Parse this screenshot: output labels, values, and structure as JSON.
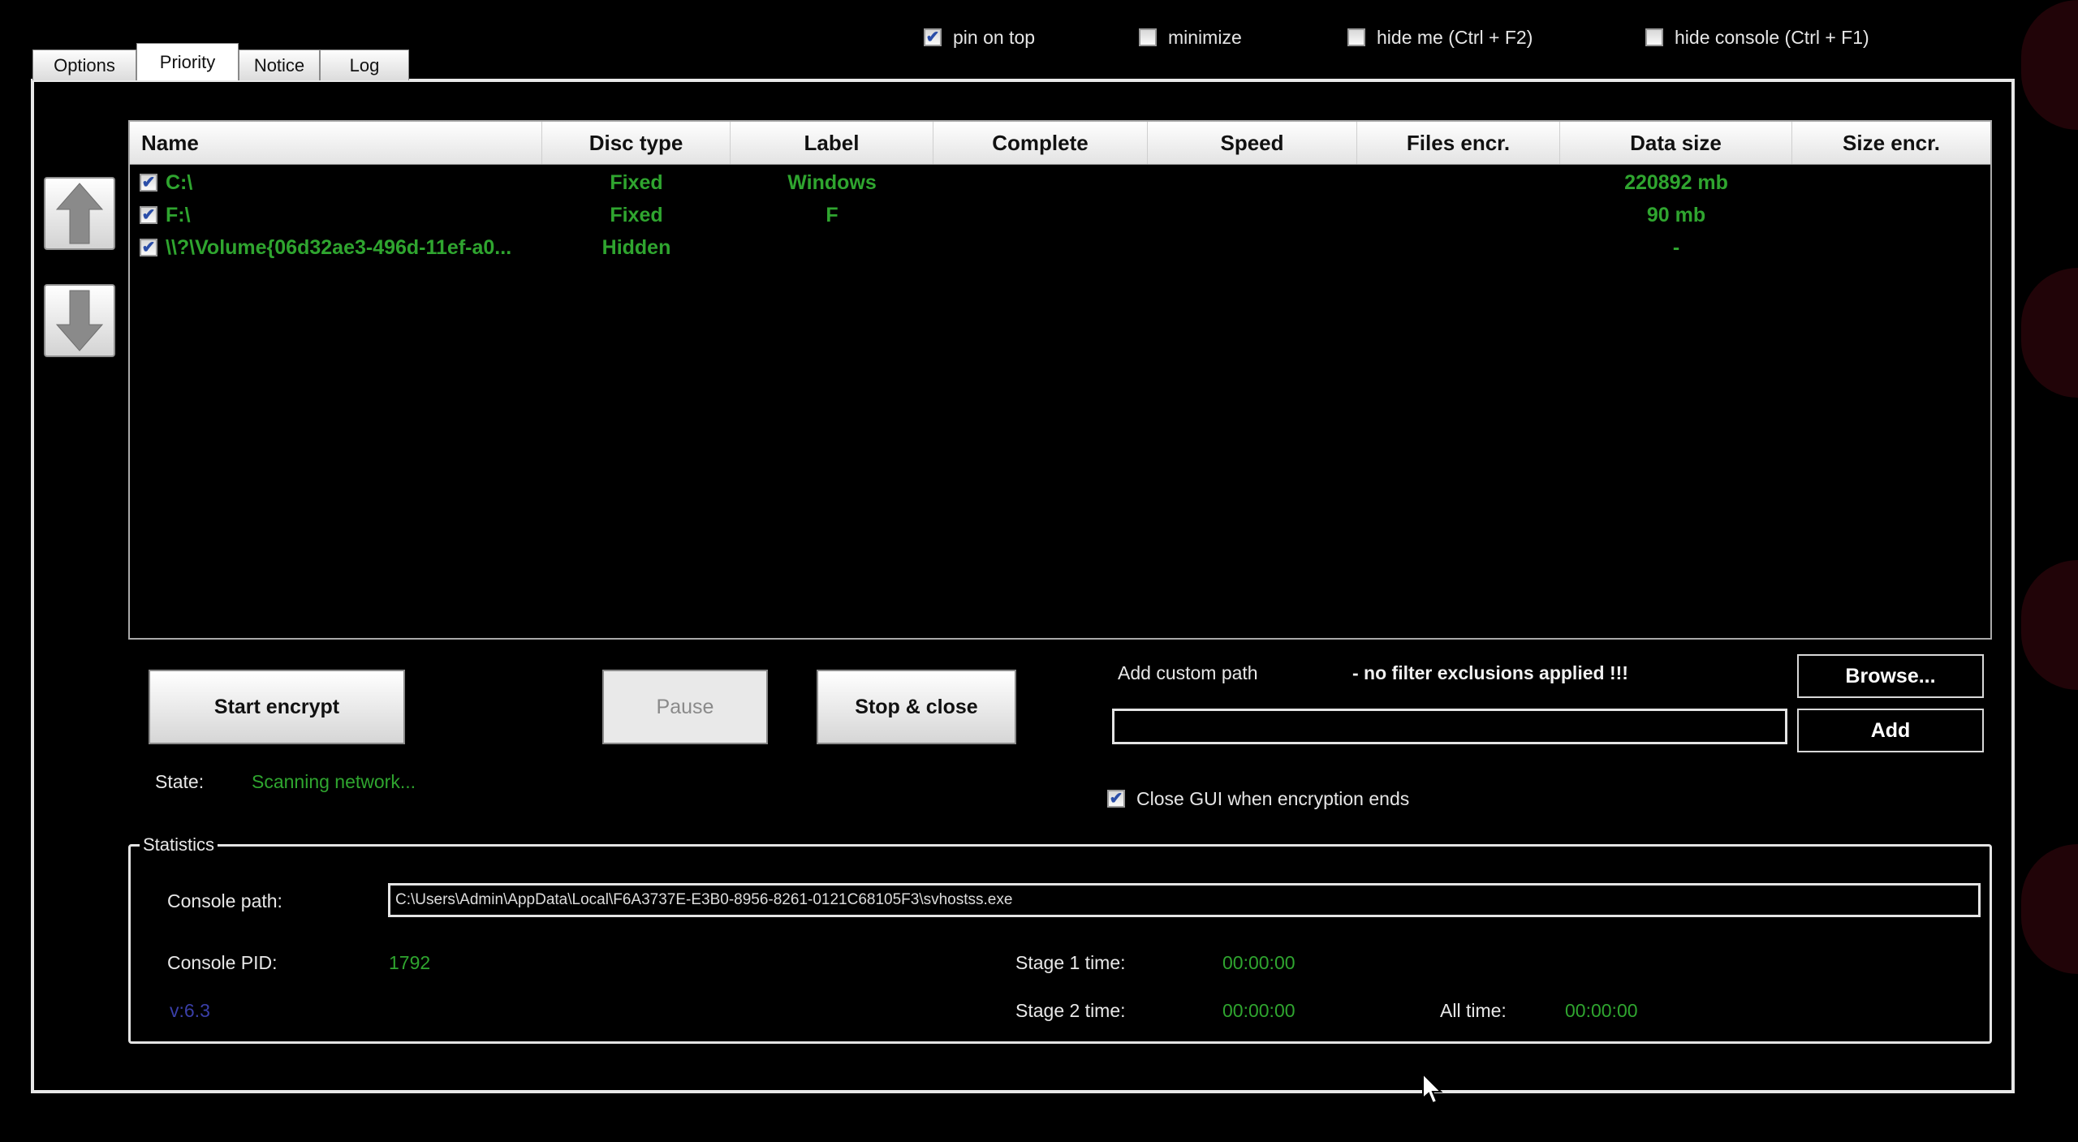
{
  "top_options": [
    {
      "label": "pin on top",
      "checked": true
    },
    {
      "label": "minimize",
      "checked": false
    },
    {
      "label": "hide me (Ctrl + F2)",
      "checked": false
    },
    {
      "label": "hide console (Ctrl + F1)",
      "checked": false
    }
  ],
  "tabs": [
    {
      "label": "Options",
      "active": false
    },
    {
      "label": "Priority",
      "active": true
    },
    {
      "label": "Notice",
      "active": false
    },
    {
      "label": "Log",
      "active": false
    }
  ],
  "table": {
    "columns": [
      "Name",
      "Disc type",
      "Label",
      "Complete",
      "Speed",
      "Files encr.",
      "Data size",
      "Size encr."
    ],
    "rows": [
      {
        "checked": true,
        "name": "C:\\",
        "disc_type": "Fixed",
        "label": "Windows",
        "complete": "",
        "speed": "",
        "files_encr": "",
        "data_size": "220892 mb",
        "size_encr": ""
      },
      {
        "checked": true,
        "name": "F:\\",
        "disc_type": "Fixed",
        "label": "F",
        "complete": "",
        "speed": "",
        "files_encr": "",
        "data_size": "90 mb",
        "size_encr": ""
      },
      {
        "checked": true,
        "name": "\\\\?\\Volume{06d32ae3-496d-11ef-a0...",
        "disc_type": "Hidden",
        "label": "",
        "complete": "",
        "speed": "",
        "files_encr": "",
        "data_size": "-",
        "size_encr": ""
      }
    ]
  },
  "controls": {
    "start_label": "Start encrypt",
    "pause_label": "Pause",
    "stop_label": "Stop & close",
    "state_label": "State:",
    "state_value": "Scanning network...",
    "custom_path_label": "Add custom path",
    "filter_warning": "- no filter exclusions applied !!!",
    "custom_path_value": "",
    "browse_label": "Browse...",
    "add_label": "Add",
    "close_gui_label": "Close GUI when encryption ends",
    "close_gui_checked": true
  },
  "statistics": {
    "title": "Statistics",
    "console_path_label": "Console path:",
    "console_path_value": "C:\\Users\\Admin\\AppData\\Local\\F6A3737E-E3B0-8956-8261-0121C68105F3\\svhostss.exe",
    "console_pid_label": "Console PID:",
    "console_pid_value": "1792",
    "version": "v:6.3",
    "stage1_label": "Stage 1 time:",
    "stage1_value": "00:00:00",
    "stage2_label": "Stage 2 time:",
    "stage2_value": "00:00:00",
    "all_time_label": "All time:",
    "all_time_value": "00:00:00"
  },
  "icons": {
    "up": "arrow-up-icon",
    "down": "arrow-down-icon",
    "cursor": "mouse-cursor-icon"
  },
  "colors": {
    "background": "#000000",
    "green_text": "#2fa52f",
    "version_text": "#3a3fa8"
  }
}
